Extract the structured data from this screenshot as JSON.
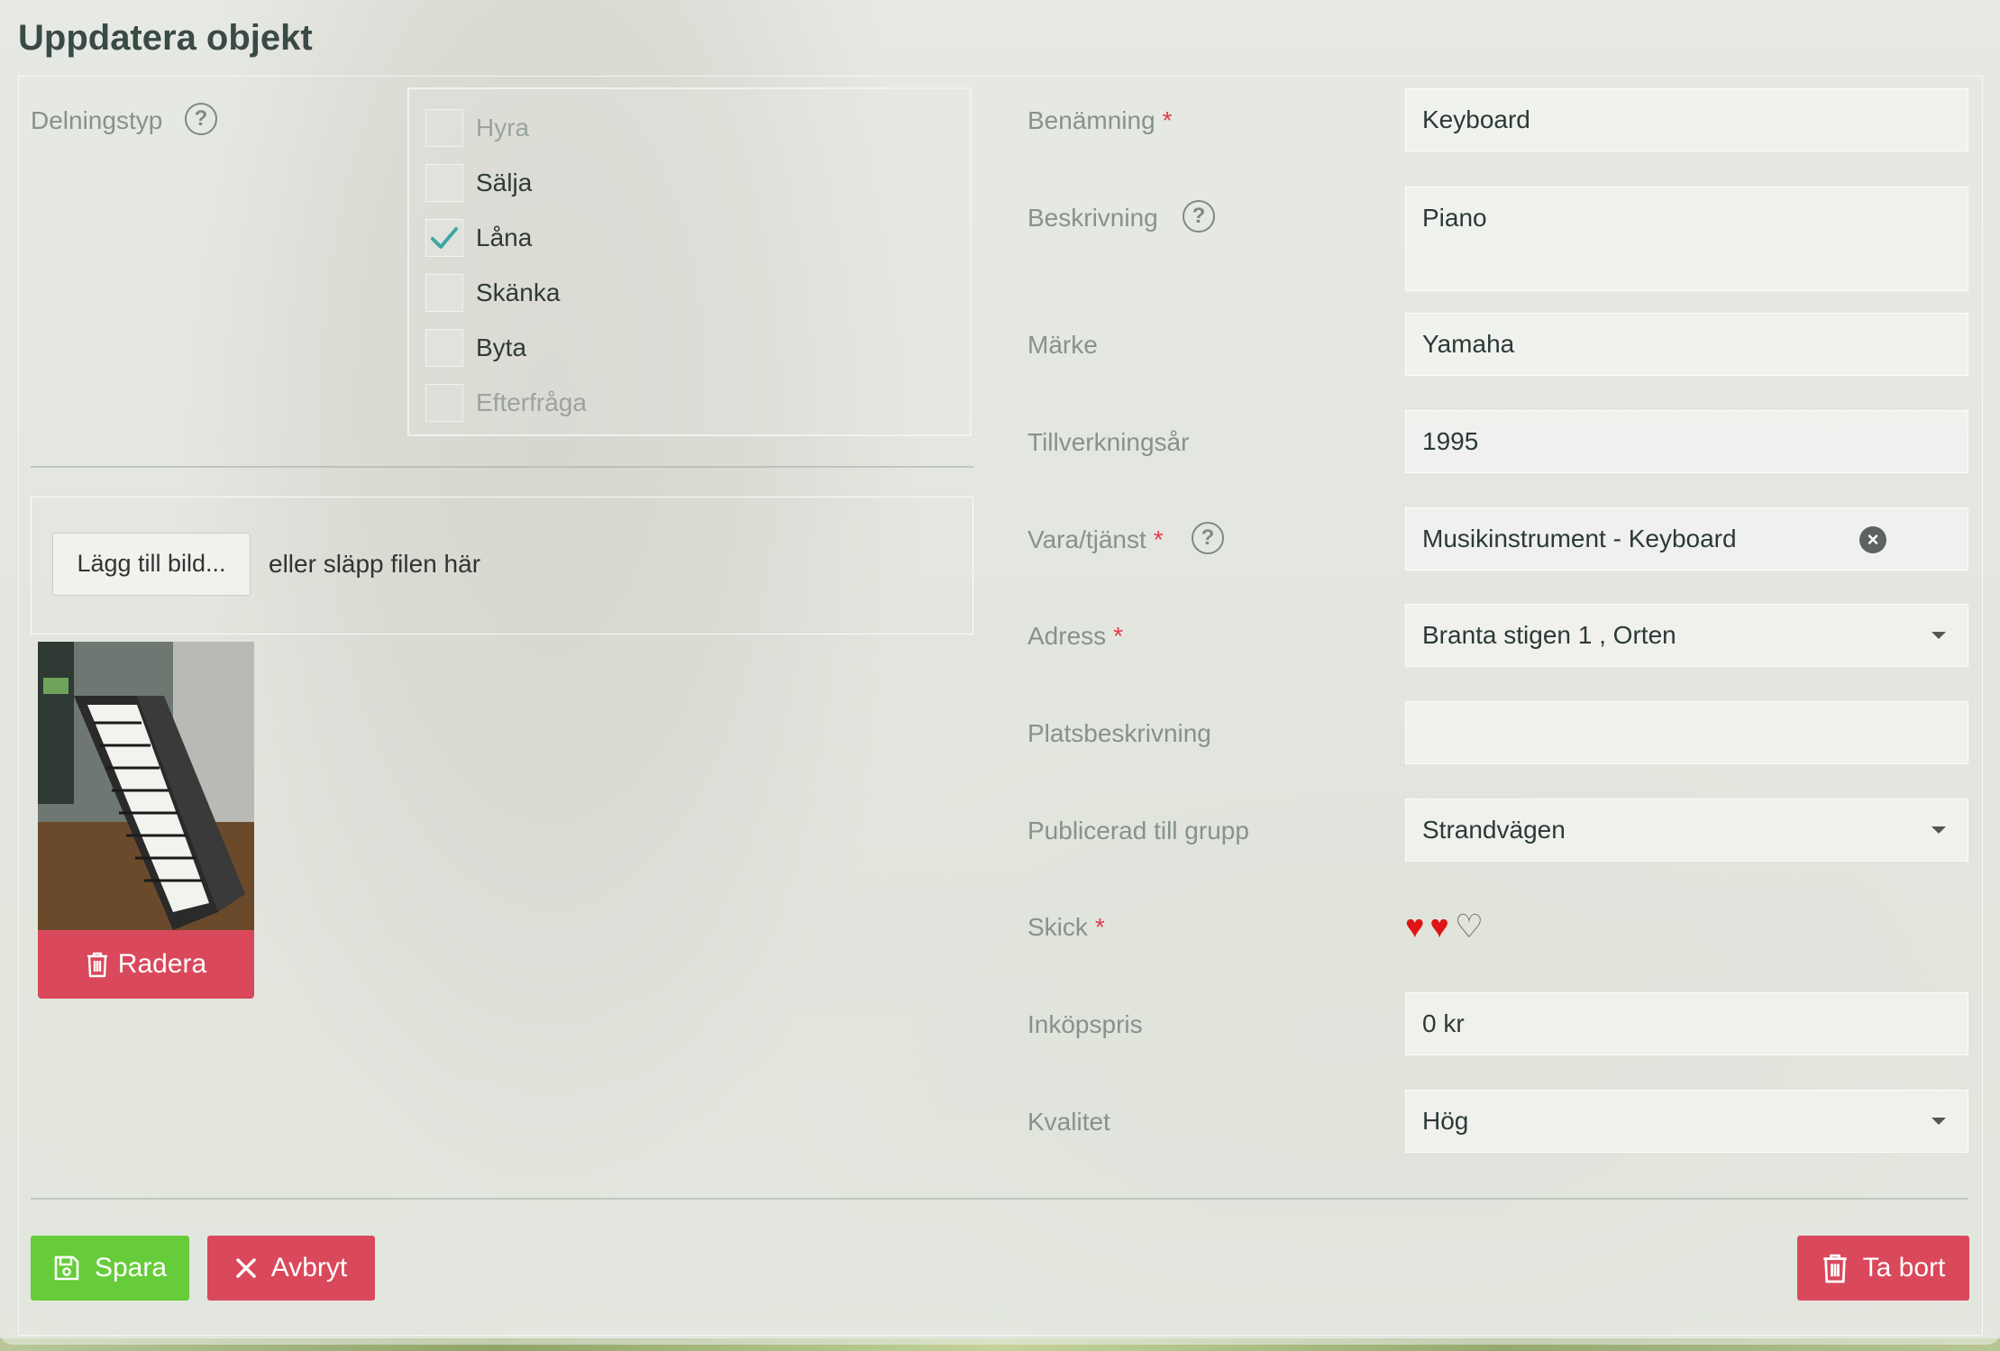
{
  "page": {
    "title": "Uppdatera objekt"
  },
  "sharing": {
    "label": "Delningstyp",
    "options": [
      {
        "label": "Hyra",
        "checked": false,
        "disabled": true
      },
      {
        "label": "Sälja",
        "checked": false,
        "disabled": false
      },
      {
        "label": "Låna",
        "checked": true,
        "disabled": false
      },
      {
        "label": "Skänka",
        "checked": false,
        "disabled": false
      },
      {
        "label": "Byta",
        "checked": false,
        "disabled": false
      },
      {
        "label": "Efterfråga",
        "checked": false,
        "disabled": true
      }
    ]
  },
  "upload": {
    "button_label": "Lägg till bild...",
    "hint": "eller släpp filen här",
    "delete_label": "Radera"
  },
  "form": {
    "name": {
      "label": "Benämning",
      "required": "*",
      "value": "Keyboard"
    },
    "description": {
      "label": "Beskrivning",
      "value": "Piano"
    },
    "brand": {
      "label": "Märke",
      "value": "Yamaha"
    },
    "year": {
      "label": "Tillverkningsår",
      "value": "1995"
    },
    "category": {
      "label": "Vara/tjänst",
      "required": "*",
      "value": "Musikinstrument - Keyboard"
    },
    "address": {
      "label": "Adress",
      "required": "*",
      "value": "Branta stigen 1 , Orten"
    },
    "location_desc": {
      "label": "Platsbeskrivning",
      "value": ""
    },
    "group": {
      "label": "Publicerad till grupp",
      "value": "Strandvägen"
    },
    "condition": {
      "label": "Skick",
      "required": "*",
      "rating": 2,
      "max": 3
    },
    "price": {
      "label": "Inköpspris",
      "value": "0 kr"
    },
    "quality": {
      "label": "Kvalitet",
      "value": "Hög"
    }
  },
  "actions": {
    "save_label": "Spara",
    "cancel_label": "Avbryt",
    "remove_label": "Ta bort"
  },
  "colors": {
    "danger": "#d9495b",
    "success": "#66cc3a",
    "required": "#e23b4d",
    "heart": "#e01414"
  },
  "icons": [
    "help-icon",
    "check-icon",
    "trash-icon",
    "save-icon",
    "close-icon",
    "clear-icon",
    "chevron-down-icon",
    "heart-icon"
  ]
}
